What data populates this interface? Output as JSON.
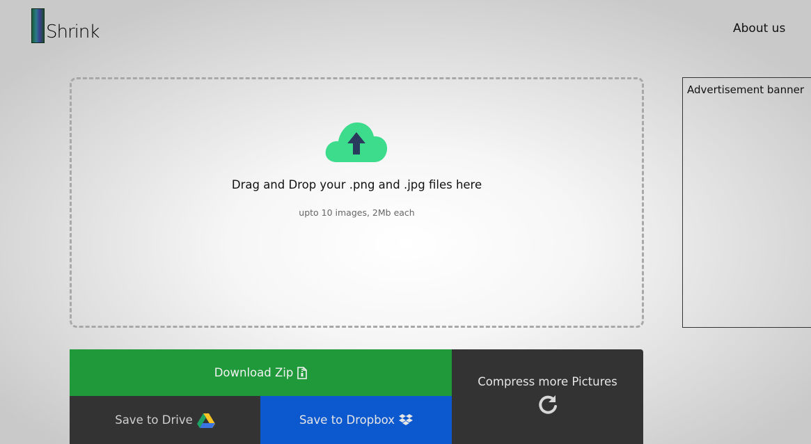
{
  "header": {
    "logo_text": "Shrink",
    "nav_about": "About us"
  },
  "upload": {
    "title": "Drag and Drop your .png and .jpg files here",
    "subtitle": "upto 10 images, 2Mb each",
    "icon": "cloud-upload-icon"
  },
  "ad": {
    "label": "Advertisement banner"
  },
  "actions": {
    "download_zip": "Download Zip",
    "save_drive": "Save to Drive",
    "save_dropbox": "Save to Dropbox",
    "compress_more": "Compress more Pictures"
  },
  "colors": {
    "zip_button": "#1f993a",
    "dropbox_button": "#0b58cf",
    "dark_button": "#333333",
    "cloud": "#3ddc8c",
    "arrow": "#2a3a5c"
  }
}
